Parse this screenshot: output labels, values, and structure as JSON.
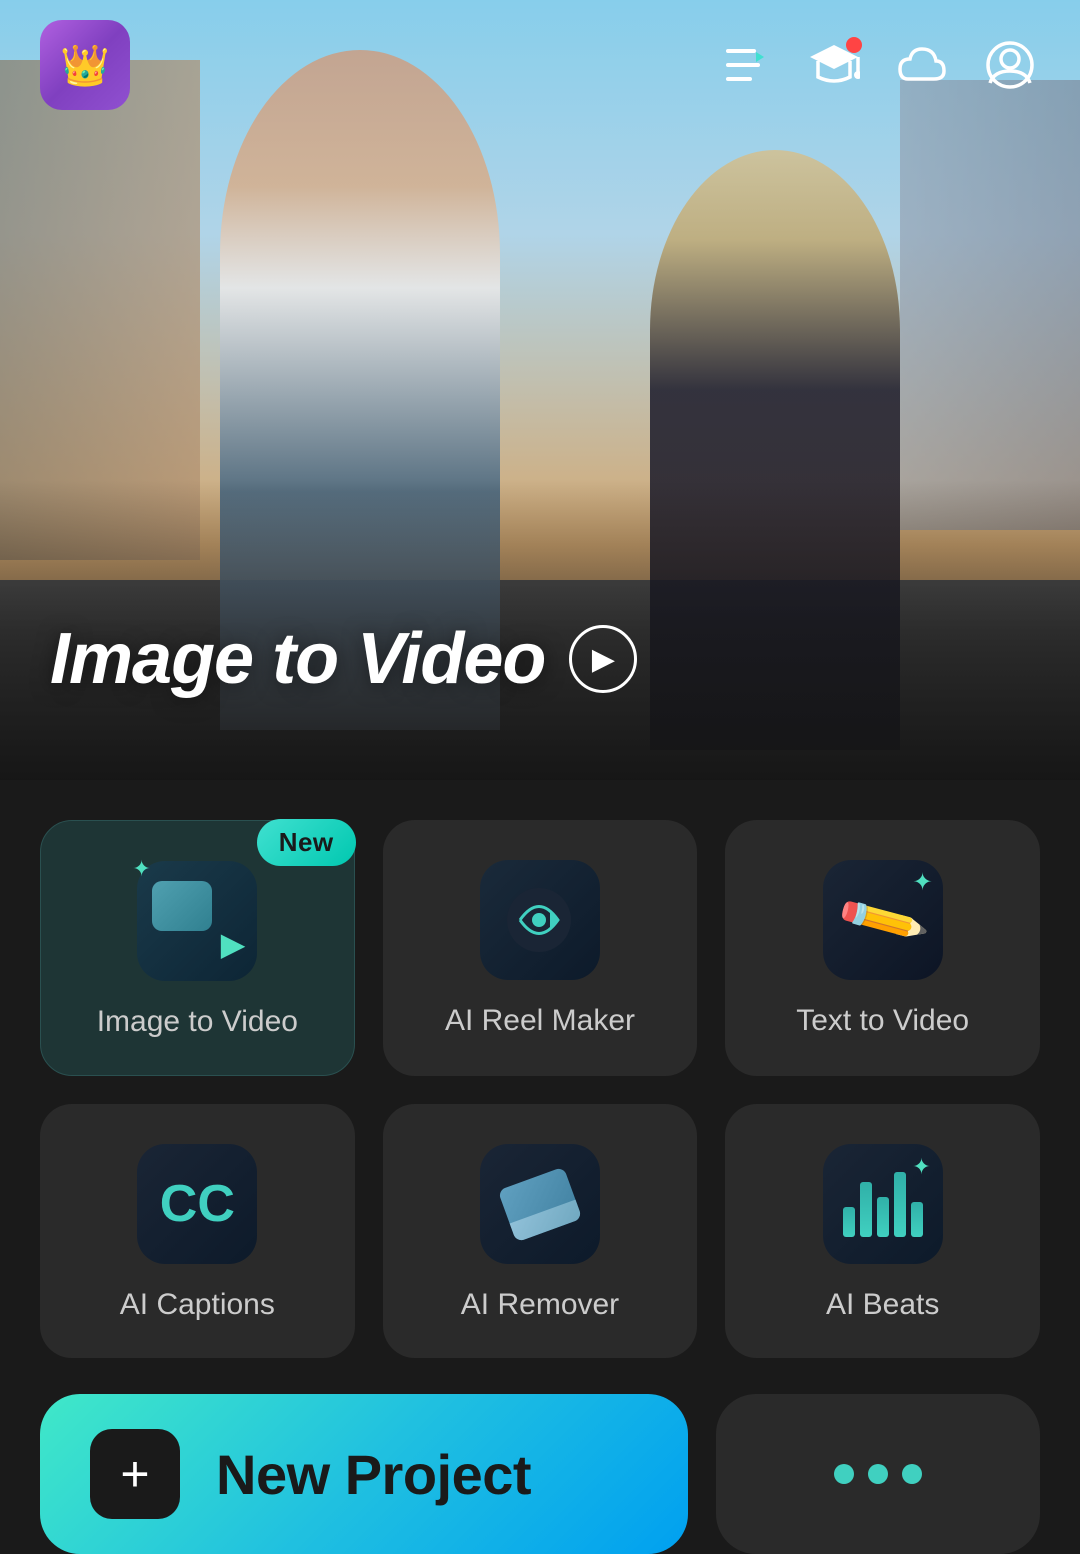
{
  "app": {
    "logo_icon": "👑"
  },
  "nav": {
    "icons": [
      {
        "name": "list-icon",
        "symbol": "≡",
        "has_badge": false
      },
      {
        "name": "education-icon",
        "symbol": "🎓",
        "has_badge": true
      },
      {
        "name": "cloud-icon",
        "symbol": "☁",
        "has_badge": false
      },
      {
        "name": "face-icon",
        "symbol": "☺",
        "has_badge": false
      }
    ]
  },
  "hero": {
    "title": "Image to Video",
    "play_button_label": "▶"
  },
  "tools": [
    {
      "id": "image-to-video",
      "label": "Image to Video",
      "is_new": true,
      "new_badge_text": "New",
      "highlight": true
    },
    {
      "id": "ai-reel-maker",
      "label": "AI Reel Maker",
      "is_new": false,
      "highlight": false
    },
    {
      "id": "text-to-video",
      "label": "Text to Video",
      "is_new": false,
      "highlight": false
    },
    {
      "id": "ai-captions",
      "label": "AI Captions",
      "is_new": false,
      "highlight": false
    },
    {
      "id": "ai-remover",
      "label": "AI Remover",
      "is_new": false,
      "highlight": false
    },
    {
      "id": "ai-beats",
      "label": "AI Beats",
      "is_new": false,
      "highlight": false
    }
  ],
  "bottom": {
    "new_project_label": "New Project",
    "more_dots": "···"
  },
  "colors": {
    "accent": "#40e0d0",
    "background": "#1a1a1a",
    "card": "#2a2a2a",
    "highlight_card": "#1e3535"
  }
}
